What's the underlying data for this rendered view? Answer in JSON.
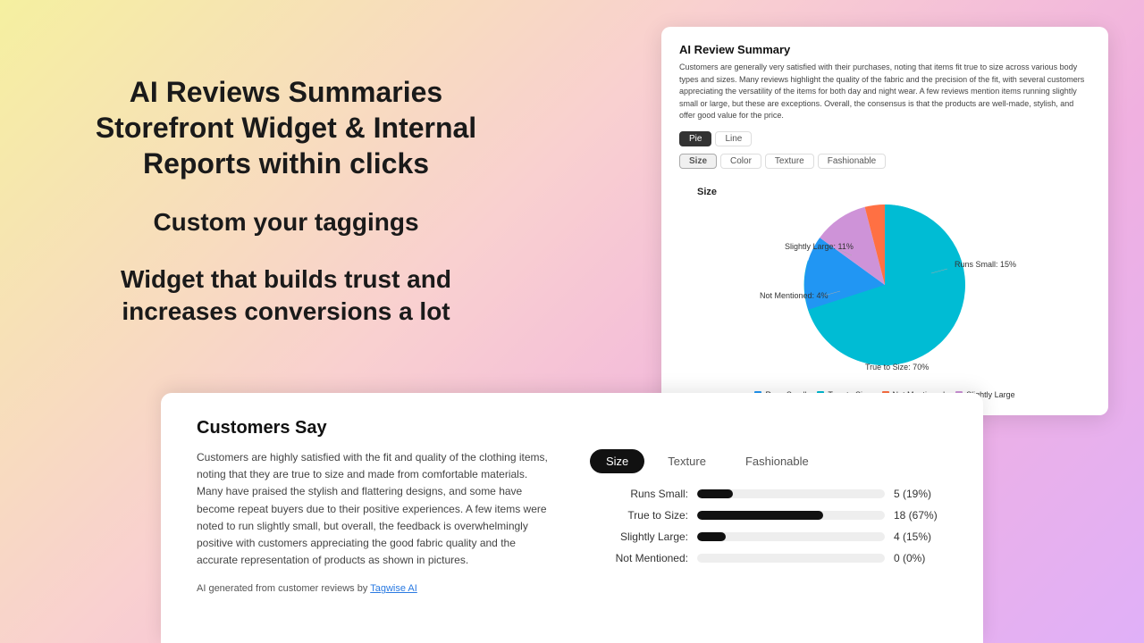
{
  "background": {
    "colors": [
      "#f5f0a0",
      "#f9d0d0",
      "#f0b0e0",
      "#e0b0f8"
    ]
  },
  "hero": {
    "line1": "AI Reviews Summaries",
    "line2": "Storefront Widget & Internal",
    "line3": "Reports within clicks",
    "line4": "Custom your taggings",
    "line5": "Widget that builds trust and",
    "line6": "increases conversions a lot"
  },
  "reviewCard": {
    "title": "AI Review Summary",
    "summary": "Customers are generally very satisfied with their purchases, noting that items fit true to size across various body types and sizes. Many reviews highlight the quality of the fabric and the precision of the fit, with several customers appreciating the versatility of the items for both day and night wear. A few reviews mention items running slightly small or large, but these are exceptions. Overall, the consensus is that the products are well-made, stylish, and offer good value for the price.",
    "toggles": [
      {
        "label": "Pie",
        "active": true
      },
      {
        "label": "Line",
        "active": false
      }
    ],
    "tags": [
      {
        "label": "Size",
        "active": true
      },
      {
        "label": "Color",
        "active": false
      },
      {
        "label": "Texture",
        "active": false
      },
      {
        "label": "Fashionable",
        "active": false
      }
    ],
    "sectionLabel": "Size",
    "pieData": [
      {
        "label": "Runs Small: 15%",
        "value": 15,
        "color": "#2196F3"
      },
      {
        "label": "True to Size: 70%",
        "value": 70,
        "color": "#00BCD4"
      },
      {
        "label": "Not Mentioned: 4%",
        "value": 4,
        "color": "#FF7043"
      },
      {
        "label": "Slightly Large: 11%",
        "value": 11,
        "color": "#CE93D8"
      }
    ],
    "legend": [
      {
        "label": "Runs Small",
        "color": "#2196F3"
      },
      {
        "label": "True to Size",
        "color": "#00BCD4"
      },
      {
        "label": "Not Mentioned",
        "color": "#FF7043"
      },
      {
        "label": "Slightly Large",
        "color": "#CE93D8"
      }
    ]
  },
  "widget": {
    "title": "Customers Say",
    "text": "Customers are highly satisfied with the fit and quality of the clothing items, noting that they are true to size and made from comfortable materials. Many have praised the stylish and flattering designs, and some have become repeat buyers due to their positive experiences. A few items were noted to run slightly small, but overall, the feedback is overwhelmingly positive with customers appreciating the good fabric quality and the accurate representation of products as shown in pictures.",
    "footerText": "AI generated from customer reviews by ",
    "footerLink": "Tagwise AI",
    "tabs": [
      {
        "label": "Size",
        "active": true
      },
      {
        "label": "Texture",
        "active": false
      },
      {
        "label": "Fashionable",
        "active": false
      }
    ],
    "bars": [
      {
        "label": "Runs Small:",
        "pct": 19,
        "display": "5 (19%)",
        "width": 19
      },
      {
        "label": "True to Size:",
        "pct": 67,
        "display": "18 (67%)",
        "width": 67
      },
      {
        "label": "Slightly Large:",
        "pct": 15,
        "display": "4 (15%)",
        "width": 15
      },
      {
        "label": "Not Mentioned:",
        "pct": 0,
        "display": "0 (0%)",
        "width": 0
      }
    ]
  }
}
